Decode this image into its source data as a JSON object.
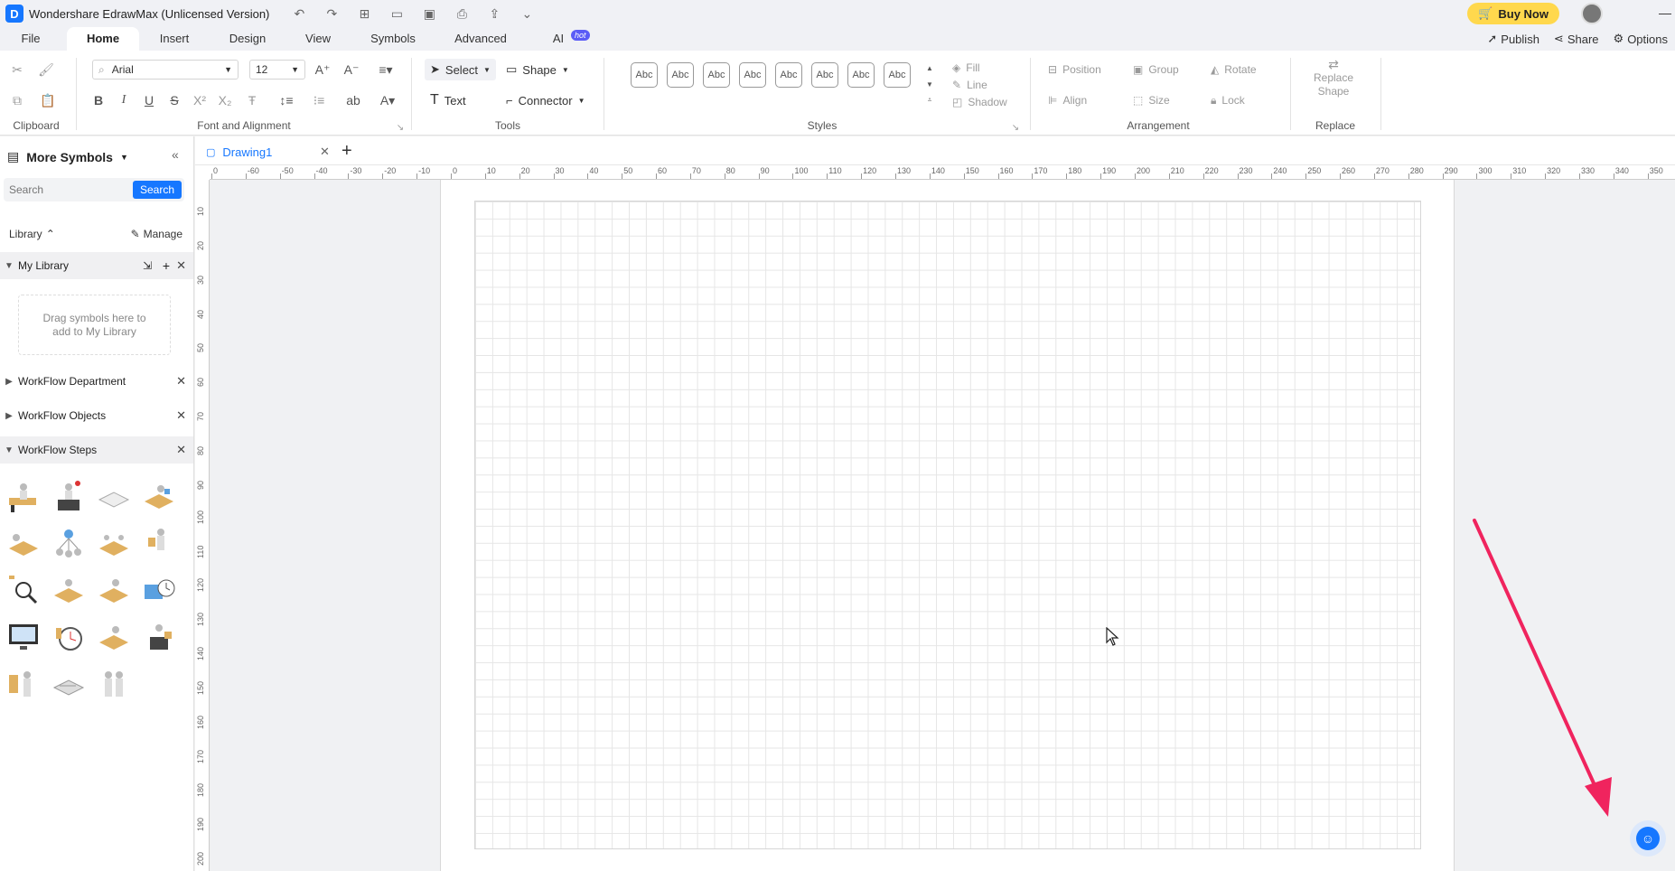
{
  "app": {
    "title": "Wondershare EdrawMax (Unlicensed Version)",
    "buy_now": "Buy Now"
  },
  "menu": {
    "tabs": [
      "File",
      "Home",
      "Insert",
      "Design",
      "View",
      "Symbols",
      "Advanced",
      "AI"
    ],
    "active": "Home",
    "ai_badge": "hot",
    "right": {
      "publish": "Publish",
      "share": "Share",
      "options": "Options"
    }
  },
  "ribbon": {
    "font_family": "Arial",
    "font_size": "12",
    "groups": {
      "clipboard": "Clipboard",
      "font": "Font and Alignment",
      "tools": "Tools",
      "styles": "Styles",
      "arrangement": "Arrangement",
      "replace": "Replace"
    },
    "tools": {
      "select": "Select",
      "shape": "Shape",
      "text": "Text",
      "connector": "Connector"
    },
    "style_swatch": "Abc",
    "format": {
      "fill": "Fill",
      "line": "Line",
      "shadow": "Shadow"
    },
    "arrange": {
      "position": "Position",
      "group": "Group",
      "rotate": "Rotate",
      "align": "Align",
      "size": "Size",
      "lock": "Lock"
    },
    "replace_shape": [
      "Replace",
      "Shape"
    ]
  },
  "left_panel": {
    "title": "More Symbols",
    "search_placeholder": "Search",
    "search_button": "Search",
    "library_label": "Library",
    "manage_label": "Manage",
    "sections": {
      "my_library": "My Library",
      "drop_hint": "Drag symbols here to add to My Library",
      "dept": "WorkFlow Department",
      "objects": "WorkFlow Objects",
      "steps": "WorkFlow Steps"
    }
  },
  "document": {
    "tab_name": "Drawing1",
    "hruler_labels": [
      "0",
      "-60",
      "-50",
      "-40",
      "-30",
      "-20",
      "-10",
      "0",
      "10",
      "20",
      "30",
      "40",
      "50",
      "60",
      "70",
      "80",
      "90",
      "100",
      "110",
      "120",
      "130",
      "140",
      "150",
      "160",
      "170",
      "180",
      "190",
      "200",
      "210",
      "220",
      "230",
      "240",
      "250",
      "260",
      "270",
      "280",
      "290",
      "300",
      "310",
      "320",
      "330",
      "340",
      "350"
    ],
    "vruler_labels": [
      "10",
      "20",
      "30",
      "40",
      "50",
      "60",
      "70",
      "80",
      "90",
      "100",
      "110",
      "120",
      "130",
      "140",
      "150",
      "160",
      "170",
      "180",
      "190",
      "200"
    ]
  },
  "colors": {
    "accent": "#1677ff",
    "buy": "#ffd84d",
    "annotation_arrow": "#f0245e"
  }
}
